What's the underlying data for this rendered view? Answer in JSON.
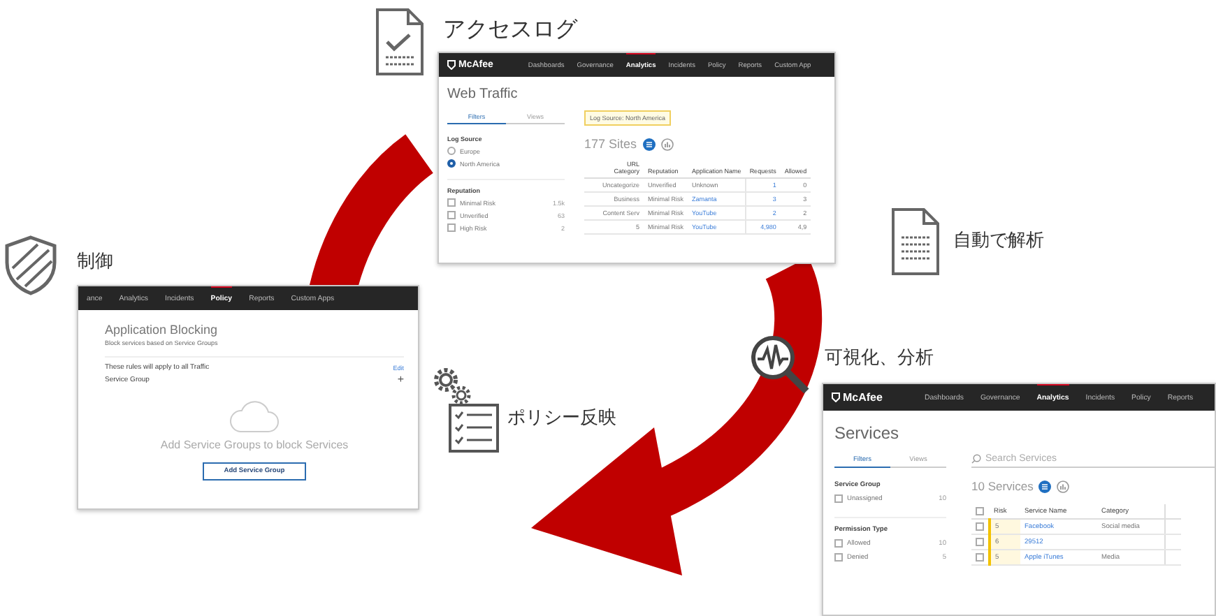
{
  "steps": [
    {
      "kind": "log",
      "label": "アクセスログ"
    },
    {
      "kind": "analyze",
      "label": "自動で解析"
    },
    {
      "kind": "visualize",
      "label": "可視化、分析"
    },
    {
      "kind": "policy",
      "label": "ポリシー反映"
    },
    {
      "kind": "control",
      "label": "制御"
    }
  ],
  "web_traffic_window": {
    "nav": {
      "logo": "McAfee",
      "items": [
        {
          "label": "Dashboards",
          "selected": false
        },
        {
          "label": "Governance",
          "selected": false
        },
        {
          "label": "Analytics",
          "selected": true
        },
        {
          "label": "Incidents",
          "selected": false
        },
        {
          "label": "Policy",
          "selected": false
        },
        {
          "label": "Reports",
          "selected": false
        },
        {
          "label": "Custom App",
          "selected": false
        }
      ]
    },
    "title": "Web Traffic",
    "tabs": [
      {
        "label": "Filters",
        "selected": true
      },
      {
        "label": "Views",
        "selected": false
      }
    ],
    "log_source": {
      "heading": "Log Source",
      "options": [
        {
          "label": "Europe",
          "selected": false
        },
        {
          "label": "North America",
          "selected": true
        }
      ]
    },
    "reputation": {
      "heading": "Reputation",
      "options": [
        {
          "label": "Minimal Risk",
          "count": "1.5k",
          "checked": false
        },
        {
          "label": "Unverified",
          "count": "63",
          "checked": false
        },
        {
          "label": "High Risk",
          "count": "2",
          "checked": false
        }
      ]
    },
    "filter_chip": "Log Source: North America",
    "count": "177 Sites",
    "table": {
      "columns": [
        "URL Category",
        "Reputation",
        "Application Name",
        "Requests",
        "Allowed"
      ],
      "rows": [
        {
          "cells": [
            "Uncategorize",
            "Unverified",
            "Unknown",
            "1",
            "0"
          ],
          "linked": false
        },
        {
          "cells": [
            "Business",
            "Minimal Risk",
            "Zamanta",
            "3",
            "3"
          ],
          "linked": true
        },
        {
          "cells": [
            "Content Serv",
            "Minimal Risk",
            "YouTube",
            "2",
            "2"
          ],
          "linked": true
        },
        {
          "cells": [
            "5",
            "Minimal Risk",
            "YouTube",
            "4,980",
            "4,9"
          ],
          "linked": true
        }
      ]
    }
  },
  "policy_window": {
    "nav": {
      "items": [
        {
          "label": "ance",
          "selected": false
        },
        {
          "label": "Analytics",
          "selected": false
        },
        {
          "label": "Incidents",
          "selected": false
        },
        {
          "label": "Policy",
          "selected": true
        },
        {
          "label": "Reports",
          "selected": false
        },
        {
          "label": "Custom Apps",
          "selected": false
        }
      ]
    },
    "title": "Application Blocking",
    "subtitle": "Block services based on Service Groups",
    "rule_text": "These rules will apply to all Traffic",
    "edit_link": "Edit",
    "service_group": "Service Group",
    "add_symbol": "+",
    "empty_message": "Add Service Groups to block Services",
    "button": "Add Service Group"
  },
  "services_window": {
    "nav": {
      "logo": "McAfee",
      "items": [
        {
          "label": "Dashboards",
          "selected": false
        },
        {
          "label": "Governance",
          "selected": false
        },
        {
          "label": "Analytics",
          "selected": true
        },
        {
          "label": "Incidents",
          "selected": false
        },
        {
          "label": "Policy",
          "selected": false
        },
        {
          "label": "Reports",
          "selected": false
        }
      ]
    },
    "title": "Services",
    "tabs": [
      {
        "label": "Filters",
        "selected": true
      },
      {
        "label": "Views",
        "selected": false
      }
    ],
    "filter_groups": [
      {
        "heading": "Service Group",
        "options": [
          {
            "label": "Unassigned",
            "count": "10",
            "checked": false
          }
        ]
      },
      {
        "heading": "Permission Type",
        "options": [
          {
            "label": "Allowed",
            "count": "10",
            "checked": false
          },
          {
            "label": "Denied",
            "count": "5",
            "checked": false
          }
        ]
      }
    ],
    "search": {
      "placeholder": "Search Services"
    },
    "count": "10 Services",
    "table": {
      "select_all_checked": false,
      "columns": [
        "Risk",
        "Service Name",
        "Category"
      ],
      "rows": [
        {
          "checked": false,
          "risk": "5",
          "name": "Facebook",
          "category": "Social media"
        },
        {
          "checked": false,
          "risk": "6",
          "name": "29512"
        },
        {
          "checked": false,
          "risk": "5",
          "name": "Apple iTunes",
          "category": "Media"
        }
      ]
    }
  }
}
